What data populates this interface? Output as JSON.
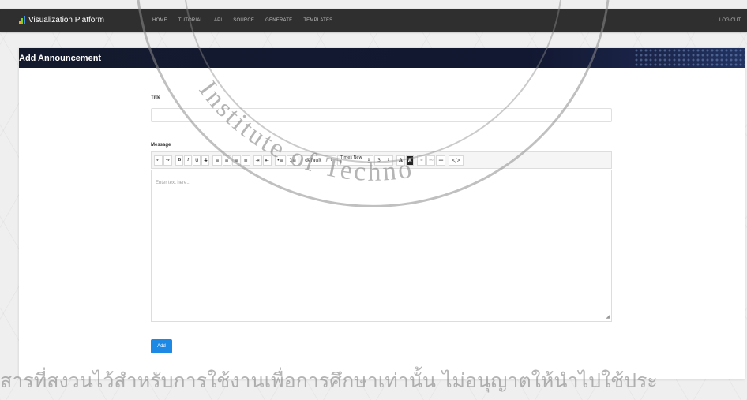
{
  "app": {
    "brand": "Visualization Platform",
    "logo_icon": "bar-chart-icon",
    "nav": [
      "HOME",
      "TUTORIAL",
      "API",
      "SOURCE",
      "GENERATE",
      "TEMPLATES"
    ],
    "logout": "LOG OUT"
  },
  "page": {
    "title": "Add Announcement"
  },
  "form": {
    "title_label": "Title",
    "title_value": "",
    "message_label": "Message",
    "message_placeholder": "Enter text here...",
    "submit_label": "Add"
  },
  "toolbar": {
    "buttons": [
      "undo-icon",
      "redo-icon",
      "bold-icon",
      "italic-icon",
      "underline-icon",
      "strikethrough-icon",
      "align-left-icon",
      "align-center-icon",
      "align-right-icon",
      "align-justify-icon",
      "indent-icon",
      "outdent-icon",
      "bulleted-list-icon",
      "numbered-list-icon",
      "font-color-icon",
      "background-color-icon",
      "link-icon",
      "unlink-icon",
      "horizontal-rule-icon",
      "code-icon"
    ],
    "block_format": "default",
    "font_family": "Times New I",
    "font_size": "3"
  },
  "watermark": {
    "seal_text": "Institute of Techno",
    "footer_text": "สารที่สงวนไว้สำหรับการใช้งานเพื่อการศึกษาเท่านั้น ไม่อนุญาตให้นำไปใช้ประ"
  },
  "colors": {
    "navbar": "#2f2f2f",
    "header": "#141a2e",
    "primary_button": "#1e88e5"
  }
}
